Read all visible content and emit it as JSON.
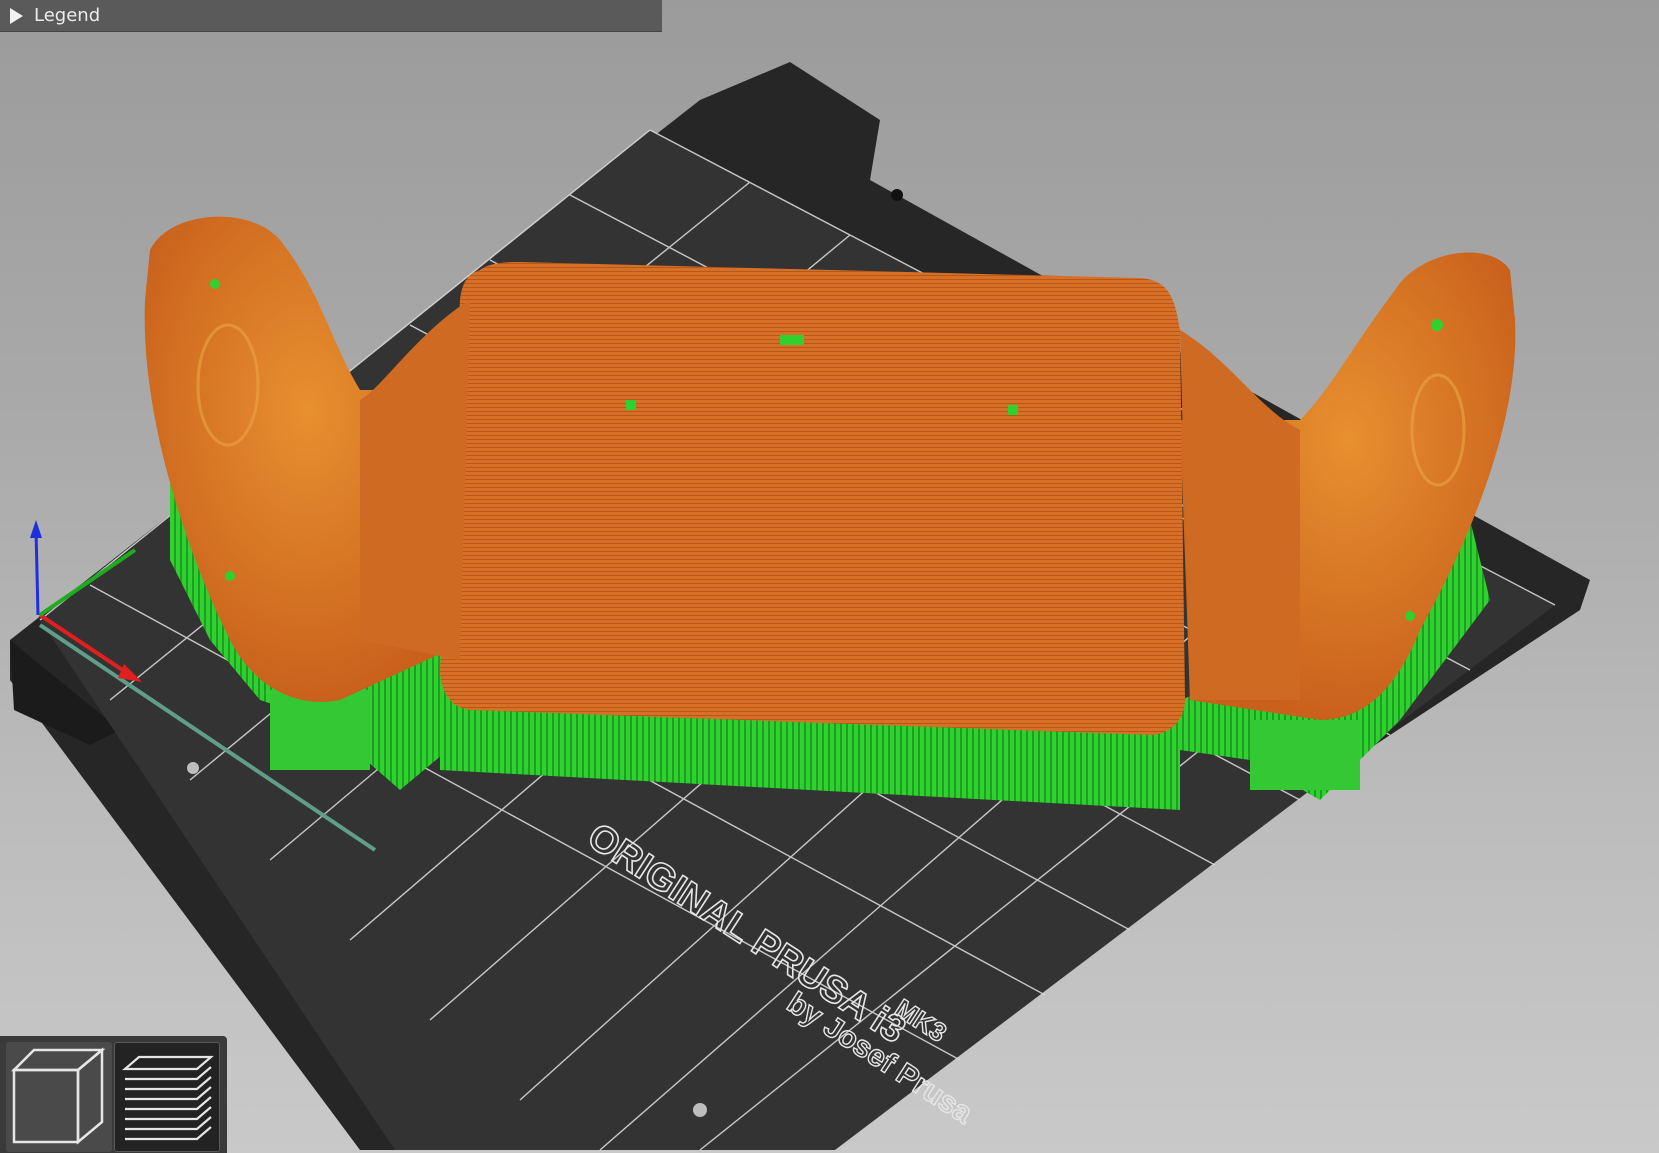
{
  "legend": {
    "label": "Legend",
    "collapsed": true
  },
  "bed": {
    "brand_line1": "ORIGINAL PRUSA i3",
    "brand_model": "MK3",
    "brand_line2": "by Josef Prusa"
  },
  "colors": {
    "background": "#a9a9a9",
    "bed_surface": "#2e2e2e",
    "grid_lines": "#e4e4e4",
    "model_perimeter": "#d9712a",
    "support_material": "#2fd12f",
    "axis_x": "#e01f1f",
    "axis_y": "#1faa1f",
    "axis_z": "#1f2fe0",
    "legend_bar": "#5a5a5a"
  },
  "view_toolbar": {
    "buttons": [
      {
        "name": "3D view",
        "icon": "cube-icon",
        "active": false
      },
      {
        "name": "Preview",
        "icon": "layers-icon",
        "active": true
      }
    ]
  }
}
